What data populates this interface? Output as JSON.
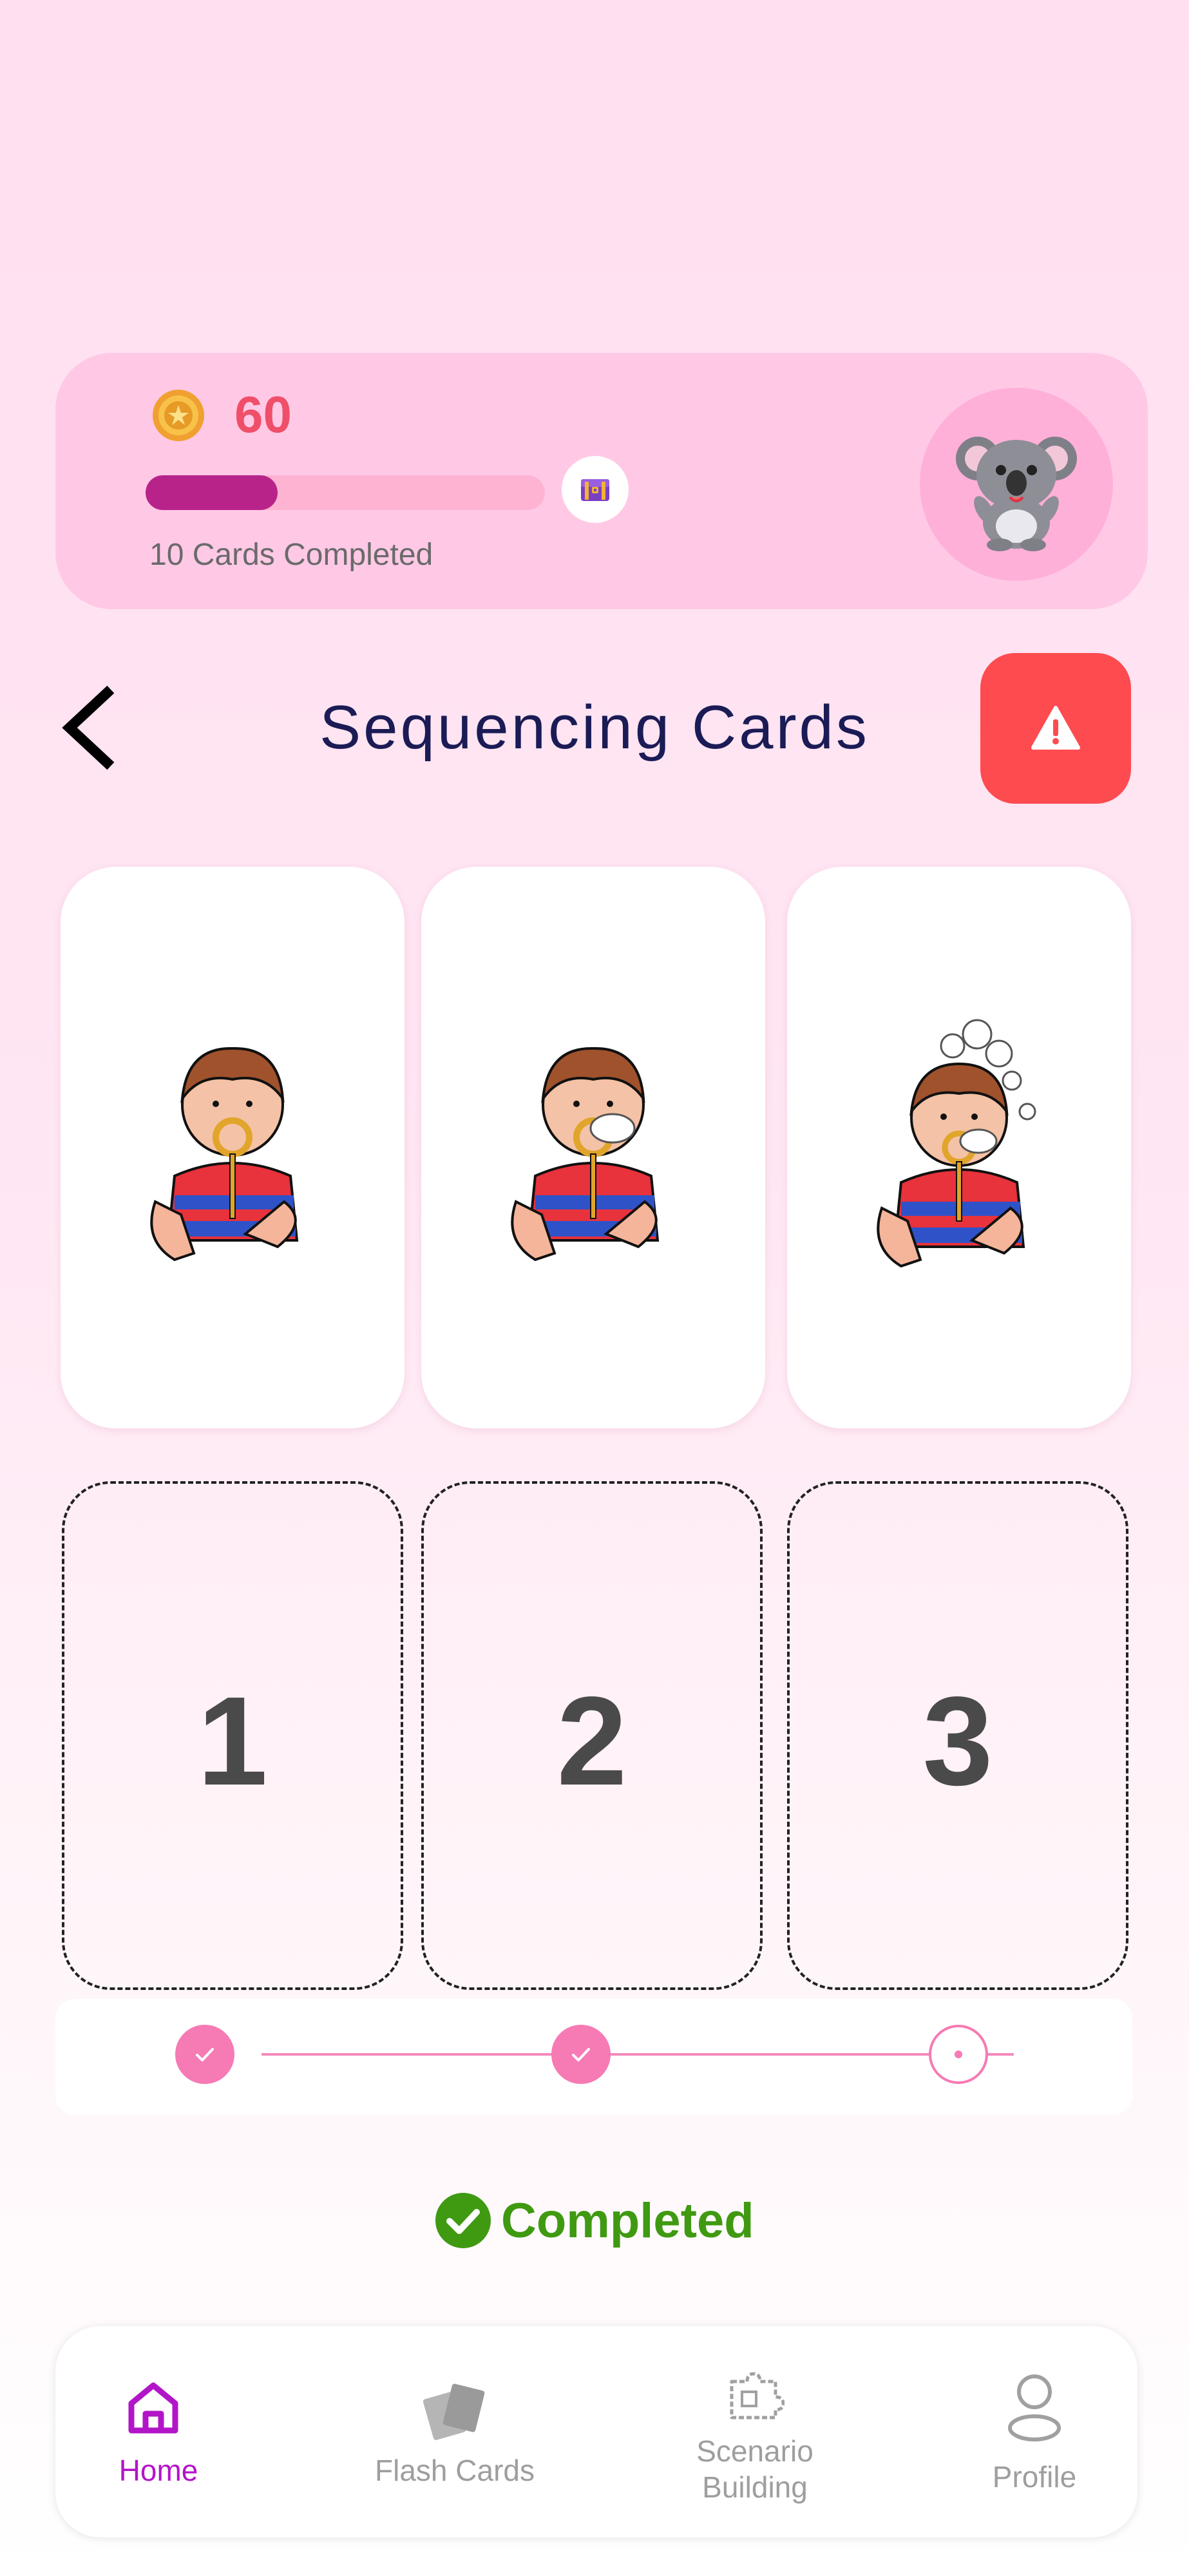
{
  "header": {
    "coins": "60",
    "progress_fraction": 0.33,
    "cards_completed_text": "10 Cards Completed"
  },
  "title": "Sequencing Cards",
  "cards": [
    {
      "icon": "boy-holding-bubble-wand-icon"
    },
    {
      "icon": "boy-blowing-bubble-icon"
    },
    {
      "icon": "boy-with-bubbles-icon"
    }
  ],
  "slots": [
    "1",
    "2",
    "3"
  ],
  "steps": [
    "done",
    "done",
    "current"
  ],
  "status": "Completed",
  "nav": {
    "home": "Home",
    "flash_cards": "Flash Cards",
    "scenario_line1": "Scenario",
    "scenario_line2": "Building",
    "profile": "Profile"
  },
  "colors": {
    "accent": "#b8238a",
    "nav_active": "#b215c8",
    "nav_inactive": "#9e9e9e",
    "alert": "#fe4b4f",
    "completed": "#3f9a12",
    "coin_text": "#ef4f69"
  }
}
